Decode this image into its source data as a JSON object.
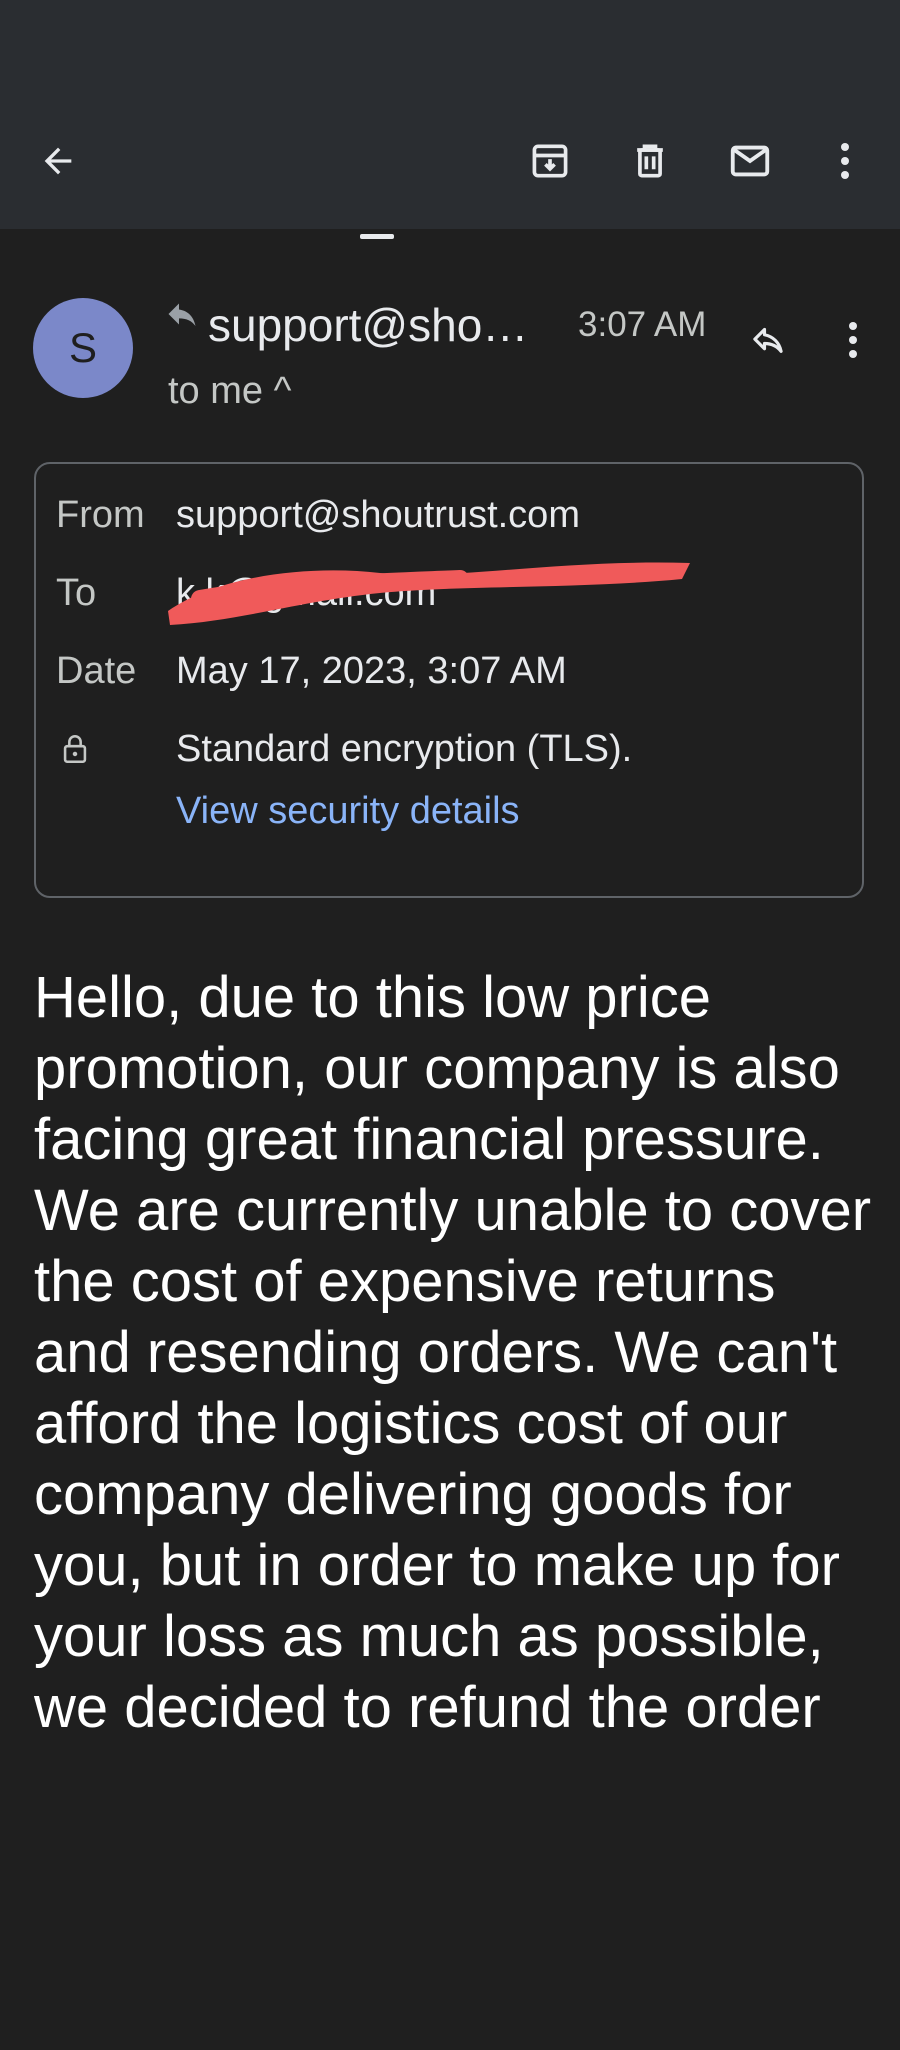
{
  "toolbar": {
    "icons": [
      "back-arrow-icon",
      "archive-icon",
      "trash-icon",
      "mail-unread-icon",
      "more-vert-icon"
    ]
  },
  "message": {
    "avatar_letter": "S",
    "sender_short": "support@sho…",
    "time": "3:07 AM",
    "recipient_summary": "to me ^"
  },
  "details": {
    "from_label": "From",
    "from_value": "support@shoutrust.com",
    "to_label": "To",
    "to_value": "k          k@gmail.com",
    "date_label": "Date",
    "date_value": "May 17, 2023, 3:07 AM",
    "encryption_text": "Standard encryption (TLS).",
    "security_link": "View security details"
  },
  "body": {
    "text": "Hello, due to this low price promotion, our company is also facing great financial pressure. We are currently unable to cover the cost of expensive returns and resending orders. We can't afford the logistics cost of our company delivering goods for you, but in order to make up for your loss as much as possible, we decided to refund the order"
  },
  "colors": {
    "background": "#1f1f1f",
    "toolbar": "#2a2d31",
    "link": "#8ab4f8",
    "avatar": "#7b88c9",
    "redaction": "#f05a5a"
  }
}
